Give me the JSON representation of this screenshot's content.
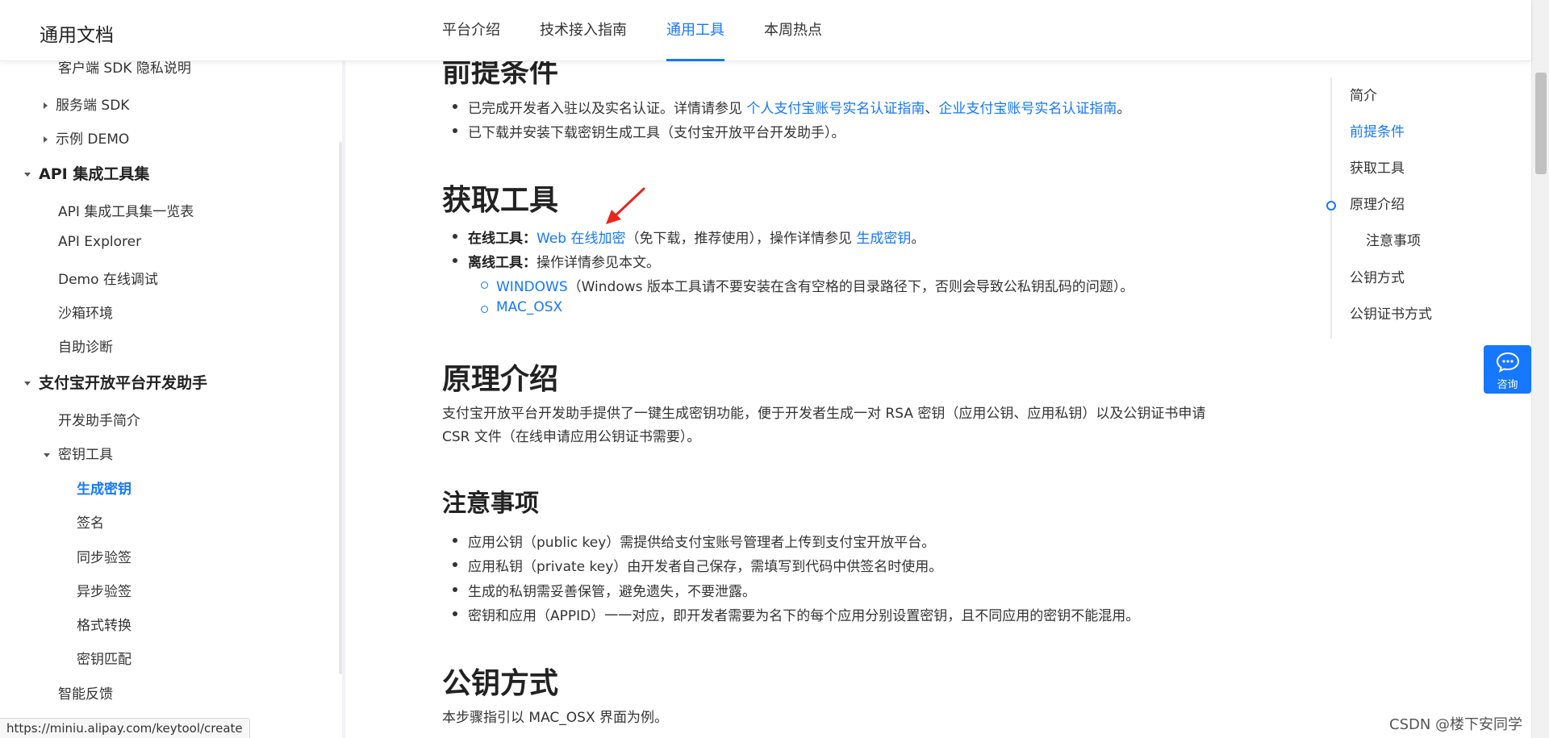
{
  "header": {
    "brand": "通用文档",
    "nav": [
      "平台介绍",
      "技术接入指南",
      "通用工具",
      "本周热点"
    ],
    "active_nav": "通用工具"
  },
  "sidebar": {
    "items": [
      {
        "label": "客户端 SDK 隐私说明"
      },
      {
        "label": "服务端 SDK"
      },
      {
        "label": "示例 DEMO"
      },
      {
        "label": "API 集成工具集"
      },
      {
        "label": "API 集成工具集一览表"
      },
      {
        "label": "API Explorer"
      },
      {
        "label": "Demo 在线调试"
      },
      {
        "label": "沙箱环境"
      },
      {
        "label": "自助诊断"
      },
      {
        "label": "支付宝开放平台开发助手"
      },
      {
        "label": "开发助手简介"
      },
      {
        "label": "密钥工具"
      },
      {
        "label": "生成密钥"
      },
      {
        "label": "签名"
      },
      {
        "label": "同步验签"
      },
      {
        "label": "异步验签"
      },
      {
        "label": "格式转换"
      },
      {
        "label": "密钥匹配"
      },
      {
        "label": "智能反馈"
      }
    ],
    "active_item": "生成密钥"
  },
  "content": {
    "prereq": {
      "title": "前提条件",
      "b1_text": "已完成开发者入驻以及实名认证。详情请参见 ",
      "b1_link1": "个人支付宝账号实名认证指南",
      "b1_sep": "、",
      "b1_link2": "企业支付宝账号实名认证指南",
      "b1_end": "。",
      "b2_text": "已下载并安装下载密钥生成工具（支付宝开放平台开发助手）。"
    },
    "tools": {
      "title": "获取工具",
      "online_label": "在线工具：",
      "online_link": "Web 在线加密",
      "online_mid": "（免下载，推荐使用），操作详情参见 ",
      "online_link2": "生成密钥",
      "online_end": "。",
      "offline_label": "离线工具：",
      "offline_text": "操作详情参见本文。",
      "windows_link": "WINDOWS",
      "windows_text": "（Windows 版本工具请不要安装在含有空格的目录路径下，否则会导致公私钥乱码的问题）。",
      "mac_link": "MAC_OSX"
    },
    "principle": {
      "title": "原理介绍",
      "text": "支付宝开放平台开发助手提供了一键生成密钥功能，便于开发者生成一对 RSA 密钥（应用公钥、应用私钥）以及公钥证书申请 CSR 文件（在线申请应用公钥证书需要）。"
    },
    "notes": {
      "title": "注意事项",
      "items": [
        "应用公钥（public key）需提供给支付宝账号管理者上传到支付宝开放平台。",
        "应用私钥（private key）由开发者自己保存，需填写到代码中供签名时使用。",
        "生成的私钥需妥善保管，避免遗失，不要泄露。",
        "密钥和应用（APPID）一一对应，即开发者需要为名下的每个应用分别设置密钥，且不同应用的密钥不能混用。"
      ]
    },
    "pubkey": {
      "title": "公钥方式",
      "text": "本步骤指引以 MAC_OSX 界面为例。"
    }
  },
  "toc": {
    "items": [
      "简介",
      "前提条件",
      "获取工具",
      "原理介绍",
      "注意事项",
      "公钥方式",
      "公钥证书方式"
    ],
    "active": "前提条件"
  },
  "consult": {
    "label": "咨询"
  },
  "statusbar": {
    "url": "https://miniu.alipay.com/keytool/create"
  },
  "watermark": "CSDN @楼下安同学",
  "colors": {
    "accent": "#1677ff",
    "annotation_arrow": "#e8261c"
  }
}
